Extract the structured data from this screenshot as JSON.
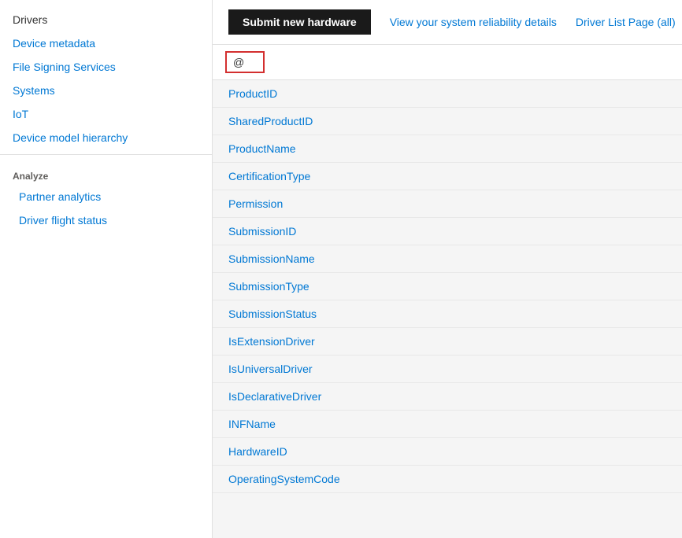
{
  "sidebar": {
    "items": [
      {
        "id": "drivers",
        "label": "Drivers",
        "type": "plain",
        "indent": false
      },
      {
        "id": "device-metadata",
        "label": "Device metadata",
        "type": "link",
        "indent": false
      },
      {
        "id": "file-signing",
        "label": "File Signing Services",
        "type": "link",
        "indent": false
      },
      {
        "id": "systems",
        "label": "Systems",
        "type": "link",
        "indent": false
      },
      {
        "id": "iot",
        "label": "IoT",
        "type": "link",
        "indent": false
      },
      {
        "id": "device-model",
        "label": "Device model hierarchy",
        "type": "link",
        "indent": false
      }
    ],
    "analyze_label": "Analyze",
    "analyze_items": [
      {
        "id": "partner-analytics",
        "label": "Partner analytics",
        "type": "link"
      },
      {
        "id": "driver-flight",
        "label": "Driver flight status",
        "type": "link"
      }
    ]
  },
  "topbar": {
    "submit_label": "Submit new hardware",
    "reliability_label": "View your system reliability details",
    "driver_list_label": "Driver List Page (all)"
  },
  "search": {
    "icon": "@"
  },
  "list": {
    "items": [
      {
        "id": "product-id",
        "label": "ProductID"
      },
      {
        "id": "shared-product-id",
        "label": "SharedProductID"
      },
      {
        "id": "product-name",
        "label": "ProductName"
      },
      {
        "id": "certification-type",
        "label": "CertificationType"
      },
      {
        "id": "permission",
        "label": "Permission"
      },
      {
        "id": "submission-id",
        "label": "SubmissionID"
      },
      {
        "id": "submission-name",
        "label": "SubmissionName"
      },
      {
        "id": "submission-type",
        "label": "SubmissionType"
      },
      {
        "id": "submission-status",
        "label": "SubmissionStatus"
      },
      {
        "id": "is-extension-driver",
        "label": "IsExtensionDriver"
      },
      {
        "id": "is-universal-driver",
        "label": "IsUniversalDriver"
      },
      {
        "id": "is-declarative-driver",
        "label": "IsDeclarativeDriver"
      },
      {
        "id": "inf-name",
        "label": "INFName"
      },
      {
        "id": "hardware-id",
        "label": "HardwareID"
      },
      {
        "id": "operating-system-code",
        "label": "OperatingSystemCode"
      }
    ]
  }
}
